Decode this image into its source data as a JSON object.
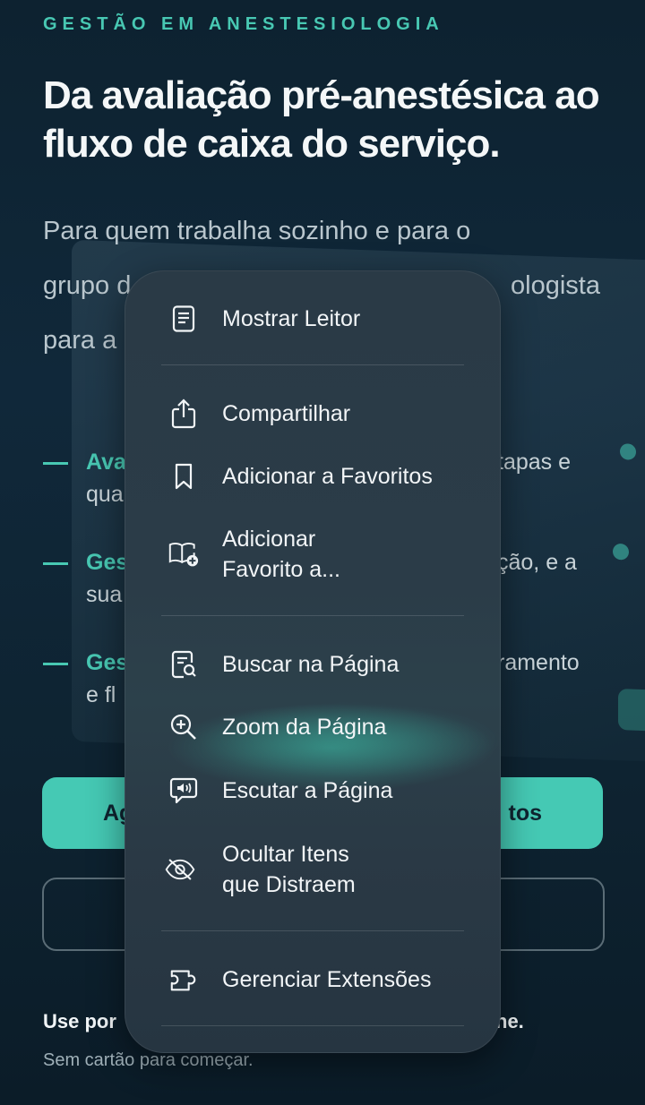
{
  "page": {
    "eyebrow": "GESTÃO EM ANESTESIOLOGIA",
    "headline": "Da avaliação pré-anestésica ao fluxo de caixa do serviço.",
    "lead_line1": "Para quem trabalha sozinho e para o",
    "lead_line2_start": "grupo d",
    "lead_line2_end": "ologista",
    "lead_line3_start": "para a",
    "features": [
      {
        "bold": "Ava",
        "after": "tapas e",
        "line2": "qua"
      },
      {
        "bold": "Ges",
        "after": "ção, e a",
        "line2": "sua"
      },
      {
        "bold": "Ges",
        "after": "ramento",
        "line2": "e fl"
      }
    ],
    "cta_primary_left": "Ag",
    "cta_primary_right": "tos",
    "footnote_bold_start": "Use por",
    "footnote_bold_end": "ne.",
    "footnote_small": "Sem cartão para começar."
  },
  "menu": {
    "items": [
      {
        "label": "Mostrar Leitor",
        "icon": "reader-icon"
      },
      {
        "label": "Compartilhar",
        "icon": "share-icon"
      },
      {
        "label": "Adicionar a Favoritos",
        "icon": "bookmark-icon"
      },
      {
        "label": "Adicionar Favorito a...",
        "line1": "Adicionar",
        "line2": "Favorito a...",
        "icon": "book-add-icon"
      },
      {
        "label": "Buscar na Página",
        "icon": "find-on-page-icon"
      },
      {
        "label": "Zoom da Página",
        "icon": "zoom-in-icon"
      },
      {
        "label": "Escutar a Página",
        "icon": "speaker-bubble-icon"
      },
      {
        "label": "Ocultar Itens que Distraem",
        "line1": "Ocultar Itens",
        "line2": "que Distraem",
        "icon": "eye-slash-icon"
      },
      {
        "label": "Gerenciar Extensões",
        "icon": "puzzle-icon"
      }
    ]
  },
  "colors": {
    "accent": "#48c8b3",
    "background": "#0d2230",
    "menu": "#2b3c48"
  }
}
